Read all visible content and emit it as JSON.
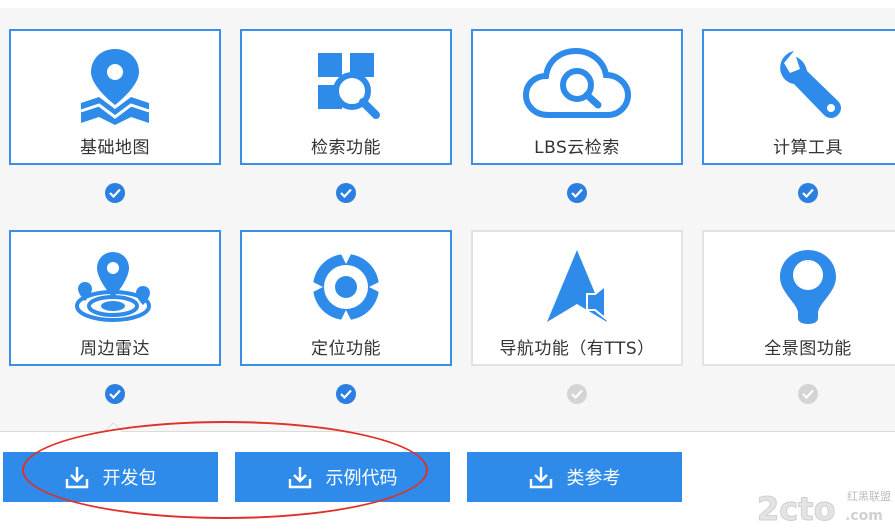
{
  "features": [
    {
      "label": "基础地图",
      "icon": "map-pin-icon",
      "selected": true
    },
    {
      "label": "检索功能",
      "icon": "search-grid-icon",
      "selected": true
    },
    {
      "label": "LBS云检索",
      "icon": "cloud-search-icon",
      "selected": true
    },
    {
      "label": "计算工具",
      "icon": "wrench-icon",
      "selected": true
    },
    {
      "label": "周边雷达",
      "icon": "radar-pin-icon",
      "selected": true
    },
    {
      "label": "定位功能",
      "icon": "locate-icon",
      "selected": true
    },
    {
      "label": "导航功能（有TTS）",
      "icon": "navigation-arrow-icon",
      "selected": false
    },
    {
      "label": "全景图功能",
      "icon": "panorama-pin-icon",
      "selected": false
    }
  ],
  "buttons": [
    {
      "label": "开发包",
      "icon": "download-icon"
    },
    {
      "label": "示例代码",
      "icon": "download-icon"
    },
    {
      "label": "类参考",
      "icon": "download-icon"
    }
  ],
  "colors": {
    "accent": "#2f8bea",
    "border": "#3b8eea",
    "check_on": "#2b7fe0",
    "check_off": "#d4d4d4",
    "annotation": "#e0302a"
  },
  "watermark": {
    "text": "2cto.com",
    "sub": "红黑联盟"
  }
}
